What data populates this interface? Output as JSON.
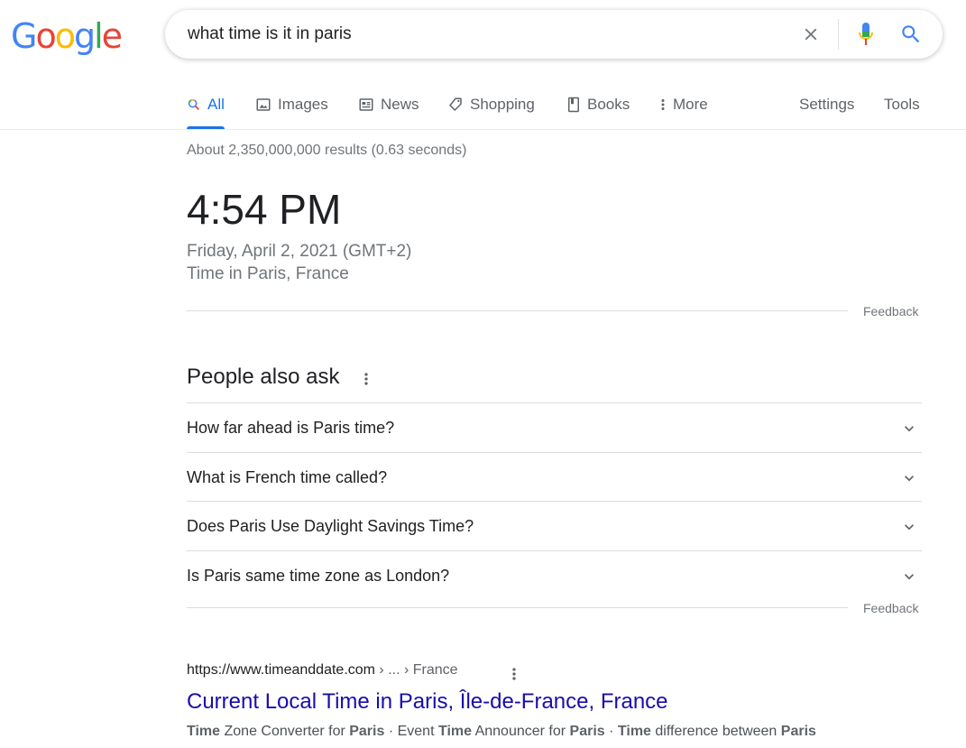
{
  "logo": {
    "letters": [
      "G",
      "o",
      "o",
      "g",
      "l",
      "e"
    ],
    "colors": [
      "#4285F4",
      "#EA4335",
      "#FBBC05",
      "#4285F4",
      "#34A853",
      "#EA4335"
    ]
  },
  "search": {
    "query": "what time is it in paris"
  },
  "tabs": [
    {
      "label": "All",
      "icon": "search-icon",
      "active": true
    },
    {
      "label": "Images",
      "icon": "image-icon"
    },
    {
      "label": "News",
      "icon": "news-icon"
    },
    {
      "label": "Shopping",
      "icon": "tag-icon"
    },
    {
      "label": "Books",
      "icon": "book-icon"
    },
    {
      "label": "More",
      "icon": "more-vert-icon"
    }
  ],
  "tools": {
    "settings": "Settings",
    "tools": "Tools"
  },
  "results_count": "About 2,350,000,000 results (0.63 seconds)",
  "time_card": {
    "time": "4:54 PM",
    "date": "Friday, April 2, 2021 (GMT+2)",
    "location": "Time in Paris, France",
    "feedback": "Feedback"
  },
  "people_also_ask": {
    "title": "People also ask",
    "questions": [
      "How far ahead is Paris time?",
      "What is French time called?",
      "Does Paris Use Daylight Savings Time?",
      "Is Paris same time zone as London?"
    ],
    "feedback": "Feedback"
  },
  "result": {
    "url": "https://www.timeanddate.com",
    "breadcrumb": " › ... › France",
    "title": "Current Local Time in Paris, Île-de-France, France",
    "snippet": [
      {
        "text": "Time",
        "bold": true
      },
      {
        "text": " Zone Converter for ",
        "bold": false
      },
      {
        "text": "Paris",
        "bold": true
      },
      {
        "text": " · Event ",
        "bold": false
      },
      {
        "text": "Time",
        "bold": true
      },
      {
        "text": " Announcer for ",
        "bold": false
      },
      {
        "text": "Paris",
        "bold": true
      },
      {
        "text": " · ",
        "bold": false
      },
      {
        "text": "Time",
        "bold": true
      },
      {
        "text": " difference between ",
        "bold": false
      },
      {
        "text": "Paris",
        "bold": true
      }
    ]
  },
  "colors": {
    "accent": "#1a73e8",
    "link": "#1a0dab",
    "muted": "#70757a"
  }
}
